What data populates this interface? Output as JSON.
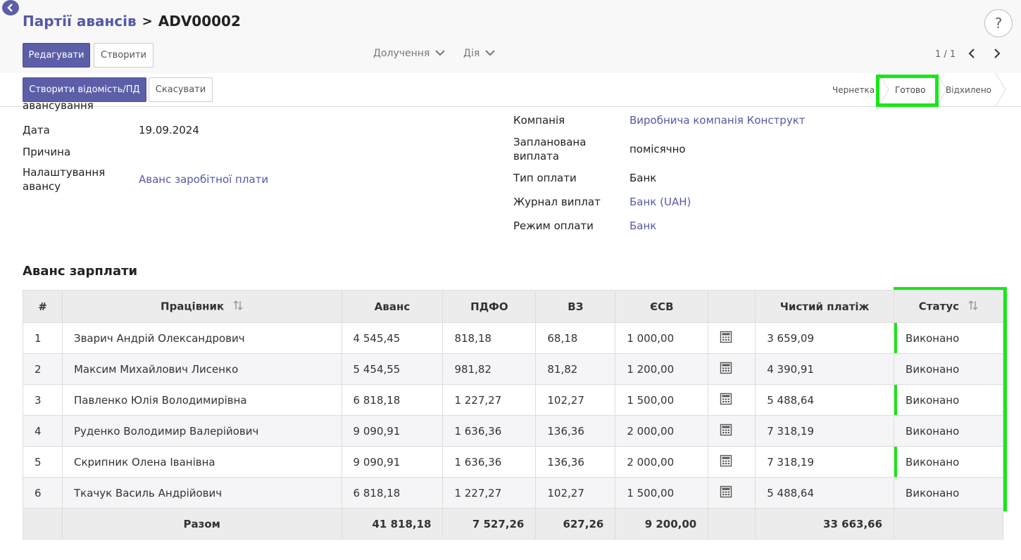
{
  "header": {
    "breadcrumb_parent": "Партії авансів",
    "breadcrumb_separator": ">",
    "breadcrumb_current": "ADV00002",
    "help_label": "?"
  },
  "toolbar": {
    "edit_label": "Редагувати",
    "create_label": "Створити",
    "attachments_label": "Долучення",
    "action_label": "Дія",
    "pager_text": "1 / 1"
  },
  "statusbar": {
    "create_statement_label": "Створити відомість/ПД",
    "cancel_label": "Скасувати",
    "stages": [
      "Чернетка",
      "Готово",
      "Відхилено"
    ],
    "active_stage": "Готово"
  },
  "form": {
    "left": {
      "partial_label": "авансування",
      "date_label": "Дата",
      "date_value": "19.09.2024",
      "reason_label": "Причина",
      "reason_value": "",
      "settings_label": "Налаштування авансу",
      "settings_value": "Аванс заробітної плати"
    },
    "right": {
      "company_label": "Компанія",
      "company_value": "Виробнича компанія Конструкт",
      "planned_label": "Запланована виплата",
      "planned_value": "помісячно",
      "paytype_label": "Тип оплати",
      "paytype_value": "Банк",
      "journal_label": "Журнал виплат",
      "journal_value": "Банк (UAH)",
      "paymode_label": "Режим оплати",
      "paymode_value": "Банк"
    }
  },
  "section": {
    "title": "Аванс зарплати"
  },
  "table": {
    "headers": {
      "num": "#",
      "employee": "Працівник",
      "advance": "Аванс",
      "pdfo": "ПДФО",
      "vz": "ВЗ",
      "esv": "ЄСВ",
      "calc": "",
      "net": "Чистий платіж",
      "status": "Статус"
    },
    "rows": [
      {
        "num": "1",
        "employee": "Зварич Андрій Олександрович",
        "advance": "4 545,45",
        "pdfo": "818,18",
        "vz": "68,18",
        "esv": "1 000,00",
        "net": "3 659,09",
        "status": "Виконано"
      },
      {
        "num": "2",
        "employee": "Максим Михайлович Лисенко",
        "advance": "5 454,55",
        "pdfo": "981,82",
        "vz": "81,82",
        "esv": "1 200,00",
        "net": "4 390,91",
        "status": "Виконано"
      },
      {
        "num": "3",
        "employee": "Павленко Юлія Володимирівна",
        "advance": "6 818,18",
        "pdfo": "1 227,27",
        "vz": "102,27",
        "esv": "1 500,00",
        "net": "5 488,64",
        "status": "Виконано"
      },
      {
        "num": "4",
        "employee": "Руденко Володимир Валерійович",
        "advance": "9 090,91",
        "pdfo": "1 636,36",
        "vz": "136,36",
        "esv": "2 000,00",
        "net": "7 318,19",
        "status": "Виконано"
      },
      {
        "num": "5",
        "employee": "Скрипник Олена Іванівна",
        "advance": "9 090,91",
        "pdfo": "1 636,36",
        "vz": "136,36",
        "esv": "2 000,00",
        "net": "7 318,19",
        "status": "Виконано"
      },
      {
        "num": "6",
        "employee": "Ткачук Василь Андрійович",
        "advance": "6 818,18",
        "pdfo": "1 227,27",
        "vz": "102,27",
        "esv": "1 500,00",
        "net": "5 488,64",
        "status": "Виконано"
      }
    ],
    "totals": {
      "label": "Разом",
      "advance": "41 818,18",
      "pdfo": "7 527,26",
      "vz": "627,26",
      "esv": "9 200,00",
      "net": "33 663,66"
    }
  },
  "icons": {
    "back": "back-arrow-icon",
    "sort": "sort-arrows-icon",
    "calc": "calculator-icon",
    "chevron": "chevron-down-icon",
    "prev": "chevron-left-icon",
    "next": "chevron-right-icon"
  },
  "colors": {
    "primary": "#5c5ea8",
    "link": "#5558a8",
    "highlight": "#19e619"
  }
}
